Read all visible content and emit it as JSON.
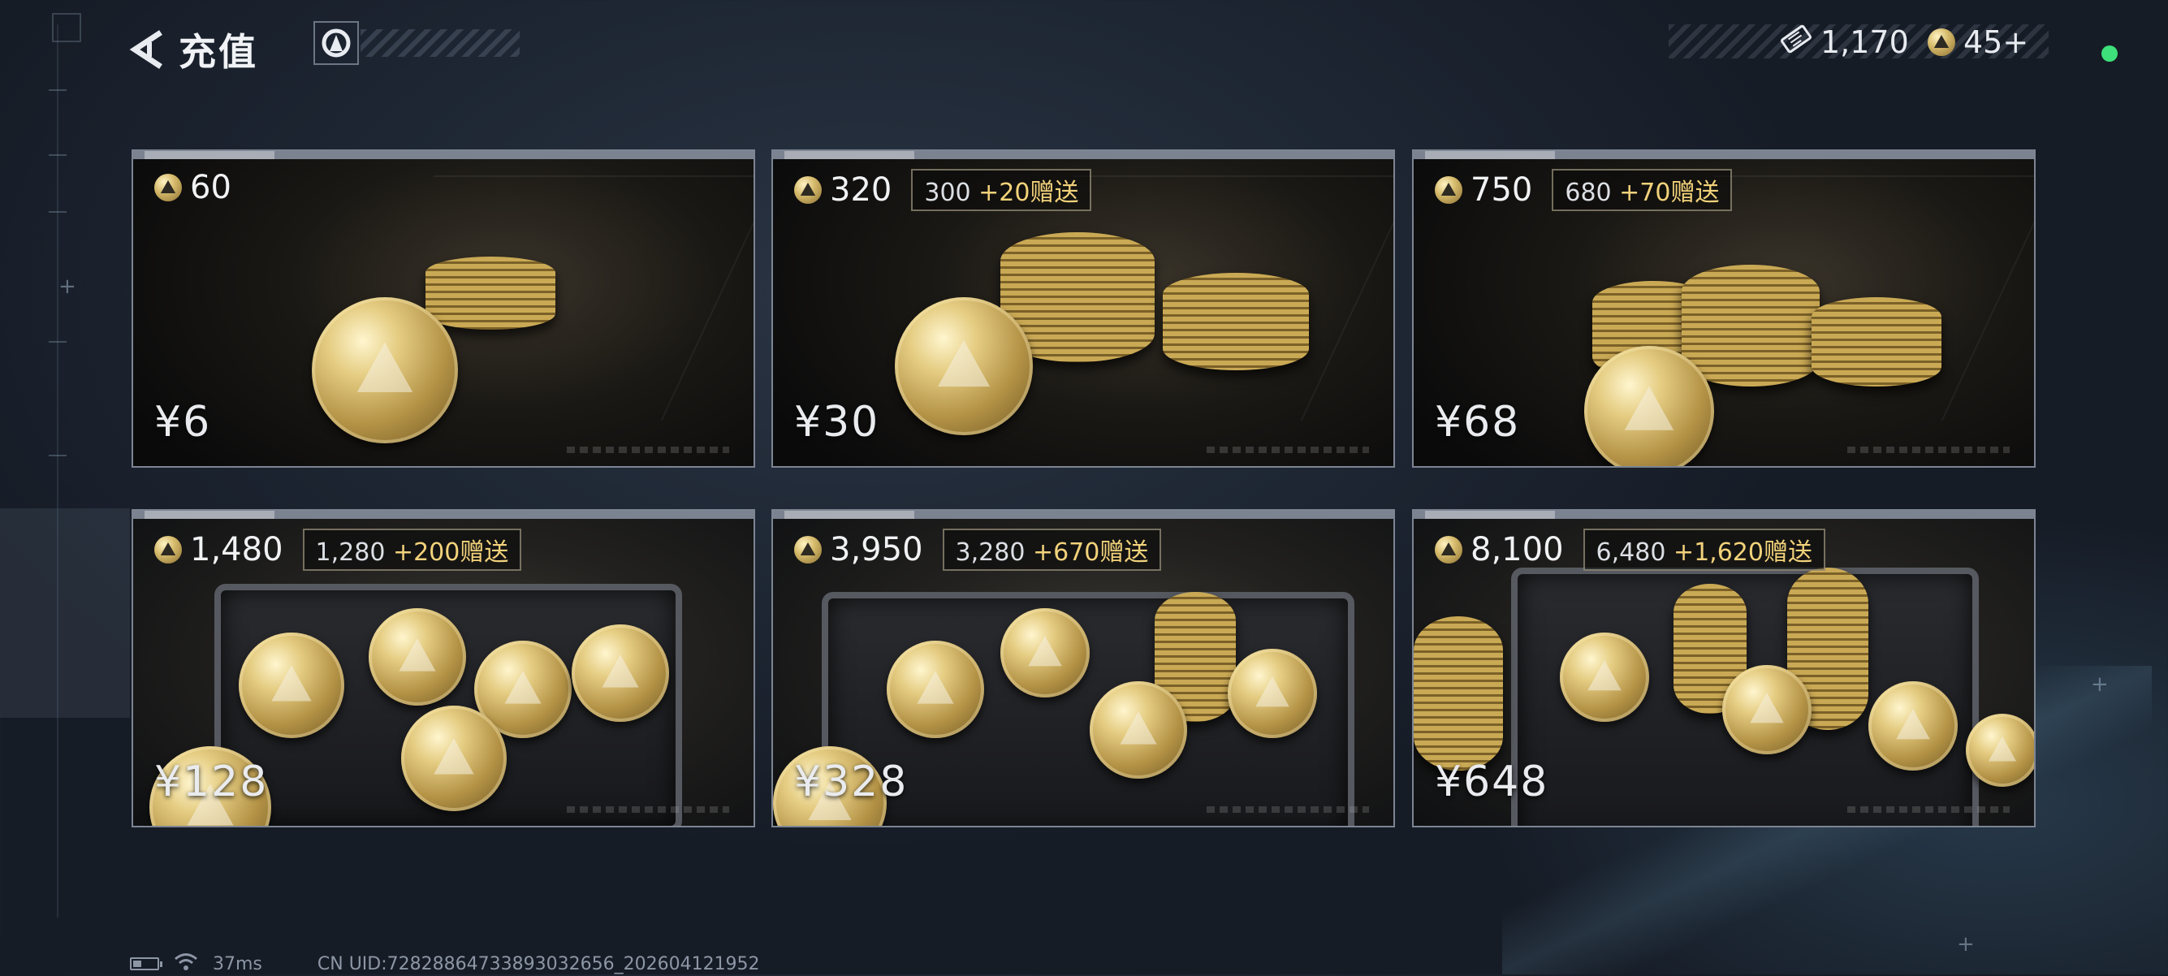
{
  "header": {
    "title": "充值",
    "back_icon": "chevron-left-icon",
    "logo_icon": "game-logo-icon"
  },
  "wallet": {
    "ticket_count": "1,170",
    "ticket_icon": "ticket-icon",
    "coin_count": "45+",
    "coin_icon": "gem-coin-icon"
  },
  "products": [
    {
      "amount": "60",
      "base": "",
      "bonus": "",
      "price": "¥6",
      "scene": "coins"
    },
    {
      "amount": "320",
      "base": "300",
      "bonus": "+20赠送",
      "price": "¥30",
      "scene": "coins"
    },
    {
      "amount": "750",
      "base": "680",
      "bonus": "+70赠送",
      "price": "¥68",
      "scene": "coins"
    },
    {
      "amount": "1,480",
      "base": "1,280",
      "bonus": "+200赠送",
      "price": "¥128",
      "scene": "chest"
    },
    {
      "amount": "3,950",
      "base": "3,280",
      "bonus": "+670赠送",
      "price": "¥328",
      "scene": "chest"
    },
    {
      "amount": "8,100",
      "base": "6,480",
      "bonus": "+1,620赠送",
      "price": "¥648",
      "scene": "chest"
    }
  ],
  "status": {
    "latency": "37ms",
    "uid": "CN UID:7282886473389303265​6_202604121952",
    "battery_level": 0.35
  },
  "colors": {
    "accent_gold": "#f2d27a",
    "online": "#3de07a",
    "background": "#1d2532"
  }
}
